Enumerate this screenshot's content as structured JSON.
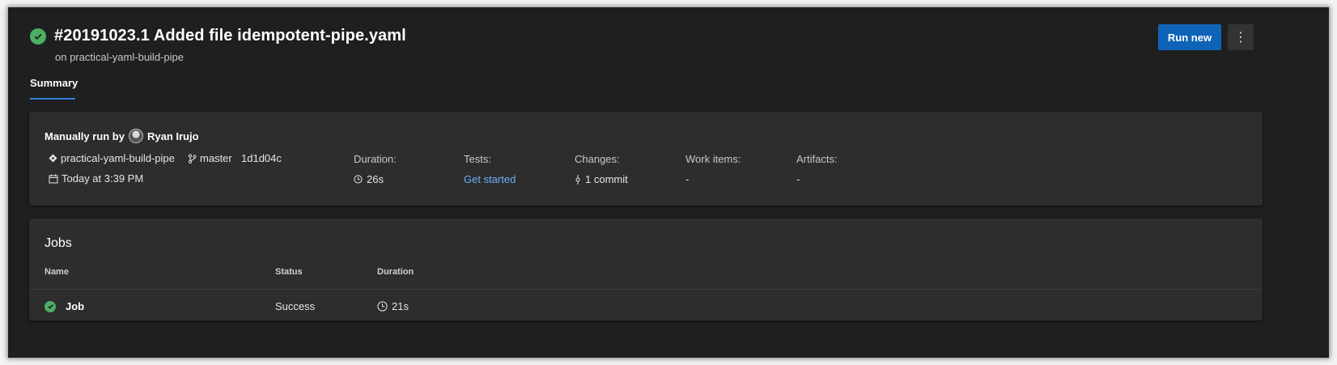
{
  "run": {
    "title": "#20191023.1 Added file idempotent-pipe.yaml",
    "subtitle": "on practical-yaml-build-pipe",
    "status_color": "#4caf63"
  },
  "tabs": [
    {
      "label": "Summary",
      "active": true
    }
  ],
  "toolbar": {
    "run_new_label": "Run new",
    "more_icon": "more-vertical-icon",
    "accent": "#0f64b8"
  },
  "summary": {
    "manual_label": "Manually run by",
    "user": "Ryan Irujo",
    "repo": "practical-yaml-build-pipe",
    "branch": "master",
    "commit": "1d1d04c",
    "time": "Today at 3:39 PM",
    "duration_label": "Duration:",
    "duration_value": "26s",
    "tests_label": "Tests:",
    "tests_value": "Get started",
    "changes_label": "Changes:",
    "changes_value": "1 commit",
    "work_items_label": "Work items:",
    "work_items_value": "-",
    "artifacts_label": "Artifacts:",
    "artifacts_value": "-"
  },
  "jobs": {
    "title": "Jobs",
    "columns": [
      "Name",
      "Status",
      "Duration"
    ],
    "rows": [
      {
        "name": "Job",
        "status": "Success",
        "duration": "21s"
      }
    ]
  }
}
